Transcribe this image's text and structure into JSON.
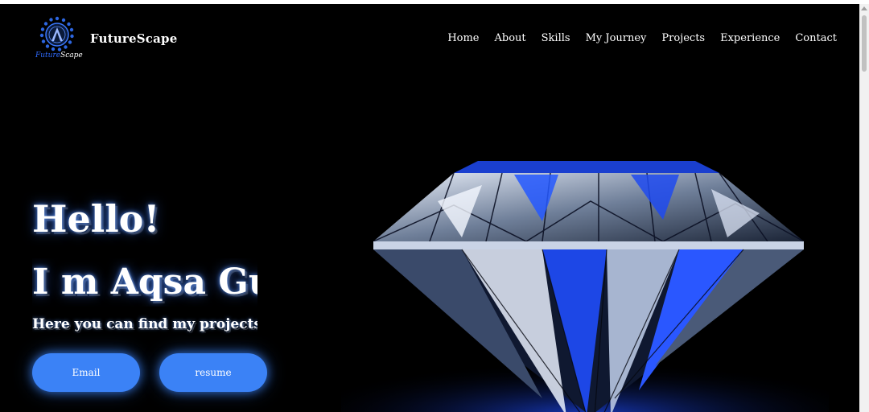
{
  "header": {
    "logo_text_part1": "Future",
    "logo_text_part2": "Scape",
    "brand": "FutureScape",
    "nav": [
      "Home",
      "About",
      "Skills",
      "My Journey",
      "Projects",
      "Experience",
      "Contact"
    ]
  },
  "hero": {
    "greeting": "Hello!",
    "name_line": "I m Aqsa Gul",
    "subtitle": "Here you can find my projects and",
    "buttons": {
      "email": "Email",
      "resume": "resume"
    }
  },
  "colors": {
    "accent": "#3b82f6",
    "background": "#000000",
    "logo_blue": "#2f6bff"
  },
  "icons": {
    "logo": "gear-ring-logo-icon",
    "hero_image": "blue-diamond-image"
  }
}
